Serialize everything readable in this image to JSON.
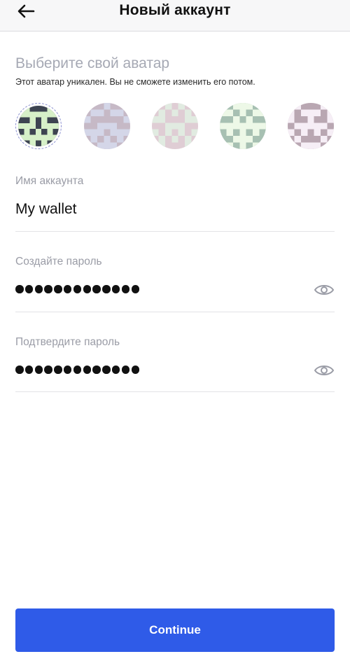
{
  "header": {
    "title": "Новый аккаунт",
    "back_icon": "arrow-left-icon"
  },
  "avatar_section": {
    "title": "Выберите свой аватар",
    "subtitle": "Этот аватар уникален. Вы не сможете изменить его потом.",
    "avatars": [
      {
        "name": "avatar-1",
        "selected": true,
        "fg": "#d6f0c8",
        "bg": "#3d4451"
      },
      {
        "name": "avatar-2",
        "selected": false,
        "fg": "#9aa0c9",
        "bg": "#7a5a7a"
      },
      {
        "name": "avatar-3",
        "selected": false,
        "fg": "#b8d0b8",
        "bg": "#b58a9a"
      },
      {
        "name": "avatar-4",
        "selected": false,
        "fg": "#d6f0c8",
        "bg": "#2f6a4a"
      },
      {
        "name": "avatar-5",
        "selected": false,
        "fg": "#ebd8ea",
        "bg": "#5a2f4a"
      }
    ]
  },
  "account_name": {
    "label": "Имя аккаунта",
    "value": "My wallet"
  },
  "password": {
    "label": "Создайте пароль",
    "masked_length": 13,
    "eye_icon": "eye-icon"
  },
  "confirm_password": {
    "label": "Подтвердите пароль",
    "masked_length": 13,
    "eye_icon": "eye-icon"
  },
  "continue": {
    "label": "Continue"
  },
  "colors": {
    "accent": "#2f5be8",
    "label_gray": "#9a9ca6",
    "divider": "#e3e3e6"
  }
}
